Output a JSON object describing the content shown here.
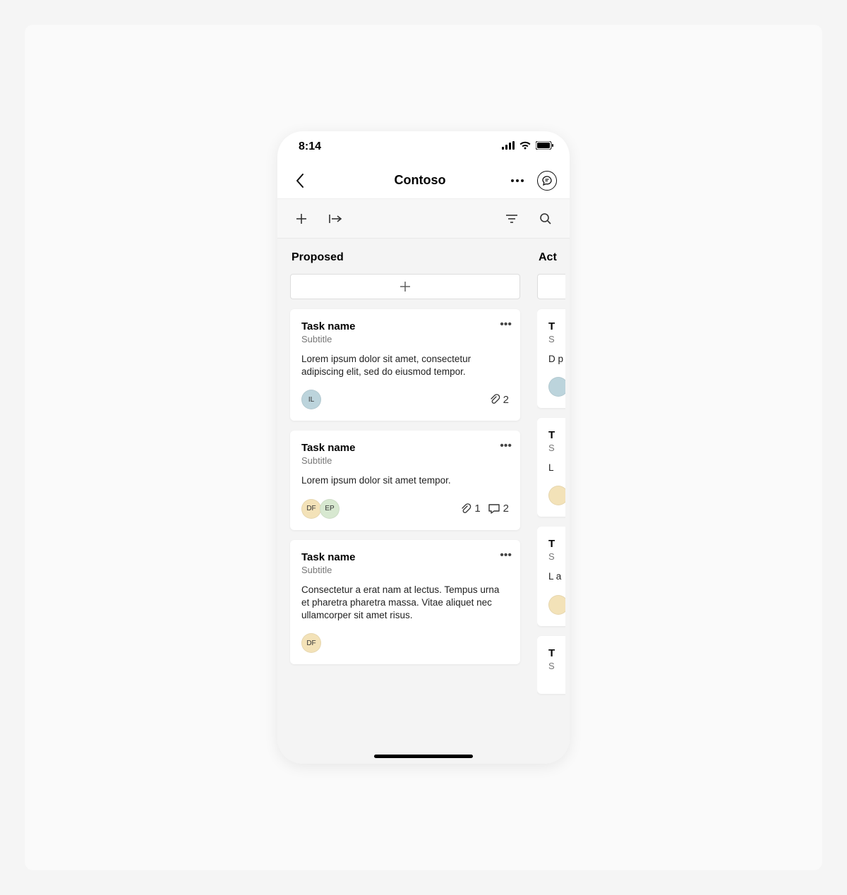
{
  "status": {
    "time": "8:14"
  },
  "header": {
    "title": "Contoso"
  },
  "columns": [
    {
      "title": "Proposed",
      "cards": [
        {
          "title": "Task name",
          "subtitle": "Subtitle",
          "body": "Lorem ipsum dolor sit amet, consectetur adipiscing elit, sed do eiusmod tempor.",
          "avatars": [
            {
              "initials": "IL",
              "bg": "#bcd4dc"
            }
          ],
          "attachments": 2,
          "comments": null
        },
        {
          "title": "Task name",
          "subtitle": "Subtitle",
          "body": "Lorem ipsum dolor sit amet tempor.",
          "avatars": [
            {
              "initials": "DF",
              "bg": "#f3e2b8"
            },
            {
              "initials": "EP",
              "bg": "#d7e8d0"
            }
          ],
          "attachments": 1,
          "comments": 2
        },
        {
          "title": "Task name",
          "subtitle": "Subtitle",
          "body": "Consectetur a erat nam at lectus. Tempus urna et pharetra pharetra massa. Vitae aliquet nec ullamcorper sit amet risus.",
          "avatars": [
            {
              "initials": "DF",
              "bg": "#f3e2b8"
            }
          ],
          "attachments": null,
          "comments": null
        }
      ]
    },
    {
      "title": "Act",
      "cards": [
        {
          "title": "T",
          "subtitle": "S",
          "body": "D\np\np",
          "avatars": [
            {
              "initials": "",
              "bg": "#bcd4dc"
            }
          ],
          "attachments": null,
          "comments": null
        },
        {
          "title": "T",
          "subtitle": "S",
          "body": "L",
          "avatars": [
            {
              "initials": "",
              "bg": "#f3e2b8"
            }
          ],
          "attachments": null,
          "comments": null
        },
        {
          "title": "T",
          "subtitle": "S",
          "body": "L\na",
          "avatars": [
            {
              "initials": "",
              "bg": "#f3e2b8"
            }
          ],
          "attachments": null,
          "comments": null
        },
        {
          "title": "T",
          "subtitle": "S",
          "body": "",
          "avatars": [],
          "attachments": null,
          "comments": null
        }
      ]
    }
  ]
}
